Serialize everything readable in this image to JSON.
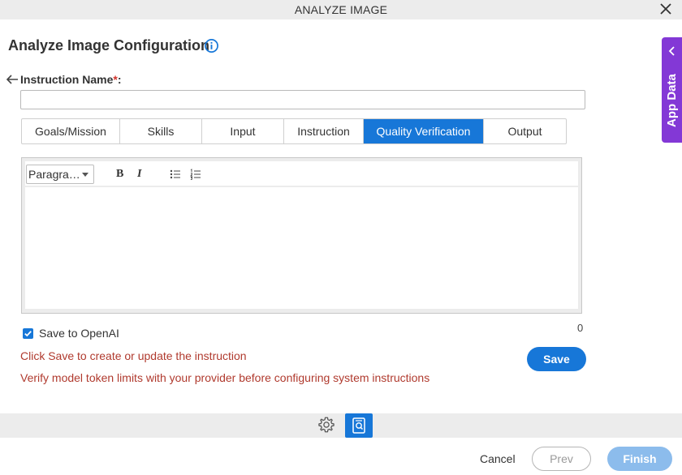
{
  "window": {
    "title": "ANALYZE IMAGE"
  },
  "page": {
    "heading": "Analyze Image Configuration"
  },
  "instruction_name": {
    "label": "Instruction Name",
    "required_mark": "*",
    "colon": ":",
    "value": ""
  },
  "tabs": [
    {
      "label": "Goals/Mission",
      "active": false
    },
    {
      "label": "Skills",
      "active": false
    },
    {
      "label": "Input",
      "active": false
    },
    {
      "label": "Instruction",
      "active": false
    },
    {
      "label": "Quality Verification",
      "active": true
    },
    {
      "label": "Output",
      "active": false
    }
  ],
  "editor": {
    "format_select": "Paragra…",
    "bold_label": "B",
    "italic_label": "I",
    "content": ""
  },
  "save_to_openai": {
    "label": "Save to OpenAI",
    "checked": true
  },
  "char_counter": "0",
  "notes": {
    "save_hint": "Click Save to create or update the instruction",
    "token_warning": "Verify model token limits with your provider before configuring system instructions"
  },
  "buttons": {
    "save": "Save",
    "cancel": "Cancel",
    "prev": "Prev",
    "finish": "Finish"
  },
  "side_panel": {
    "label": "App Data"
  },
  "colors": {
    "accent": "#1777d8",
    "side_panel": "#8338d6",
    "warning_text": "#b03a2e",
    "finish_disabled": "#8cbcec"
  },
  "icons": [
    "close-icon",
    "info-icon",
    "back-arrow-icon",
    "bullet-list-icon",
    "numbered-list-icon",
    "gear-icon",
    "image-preview-icon",
    "chevron-left-icon"
  ]
}
